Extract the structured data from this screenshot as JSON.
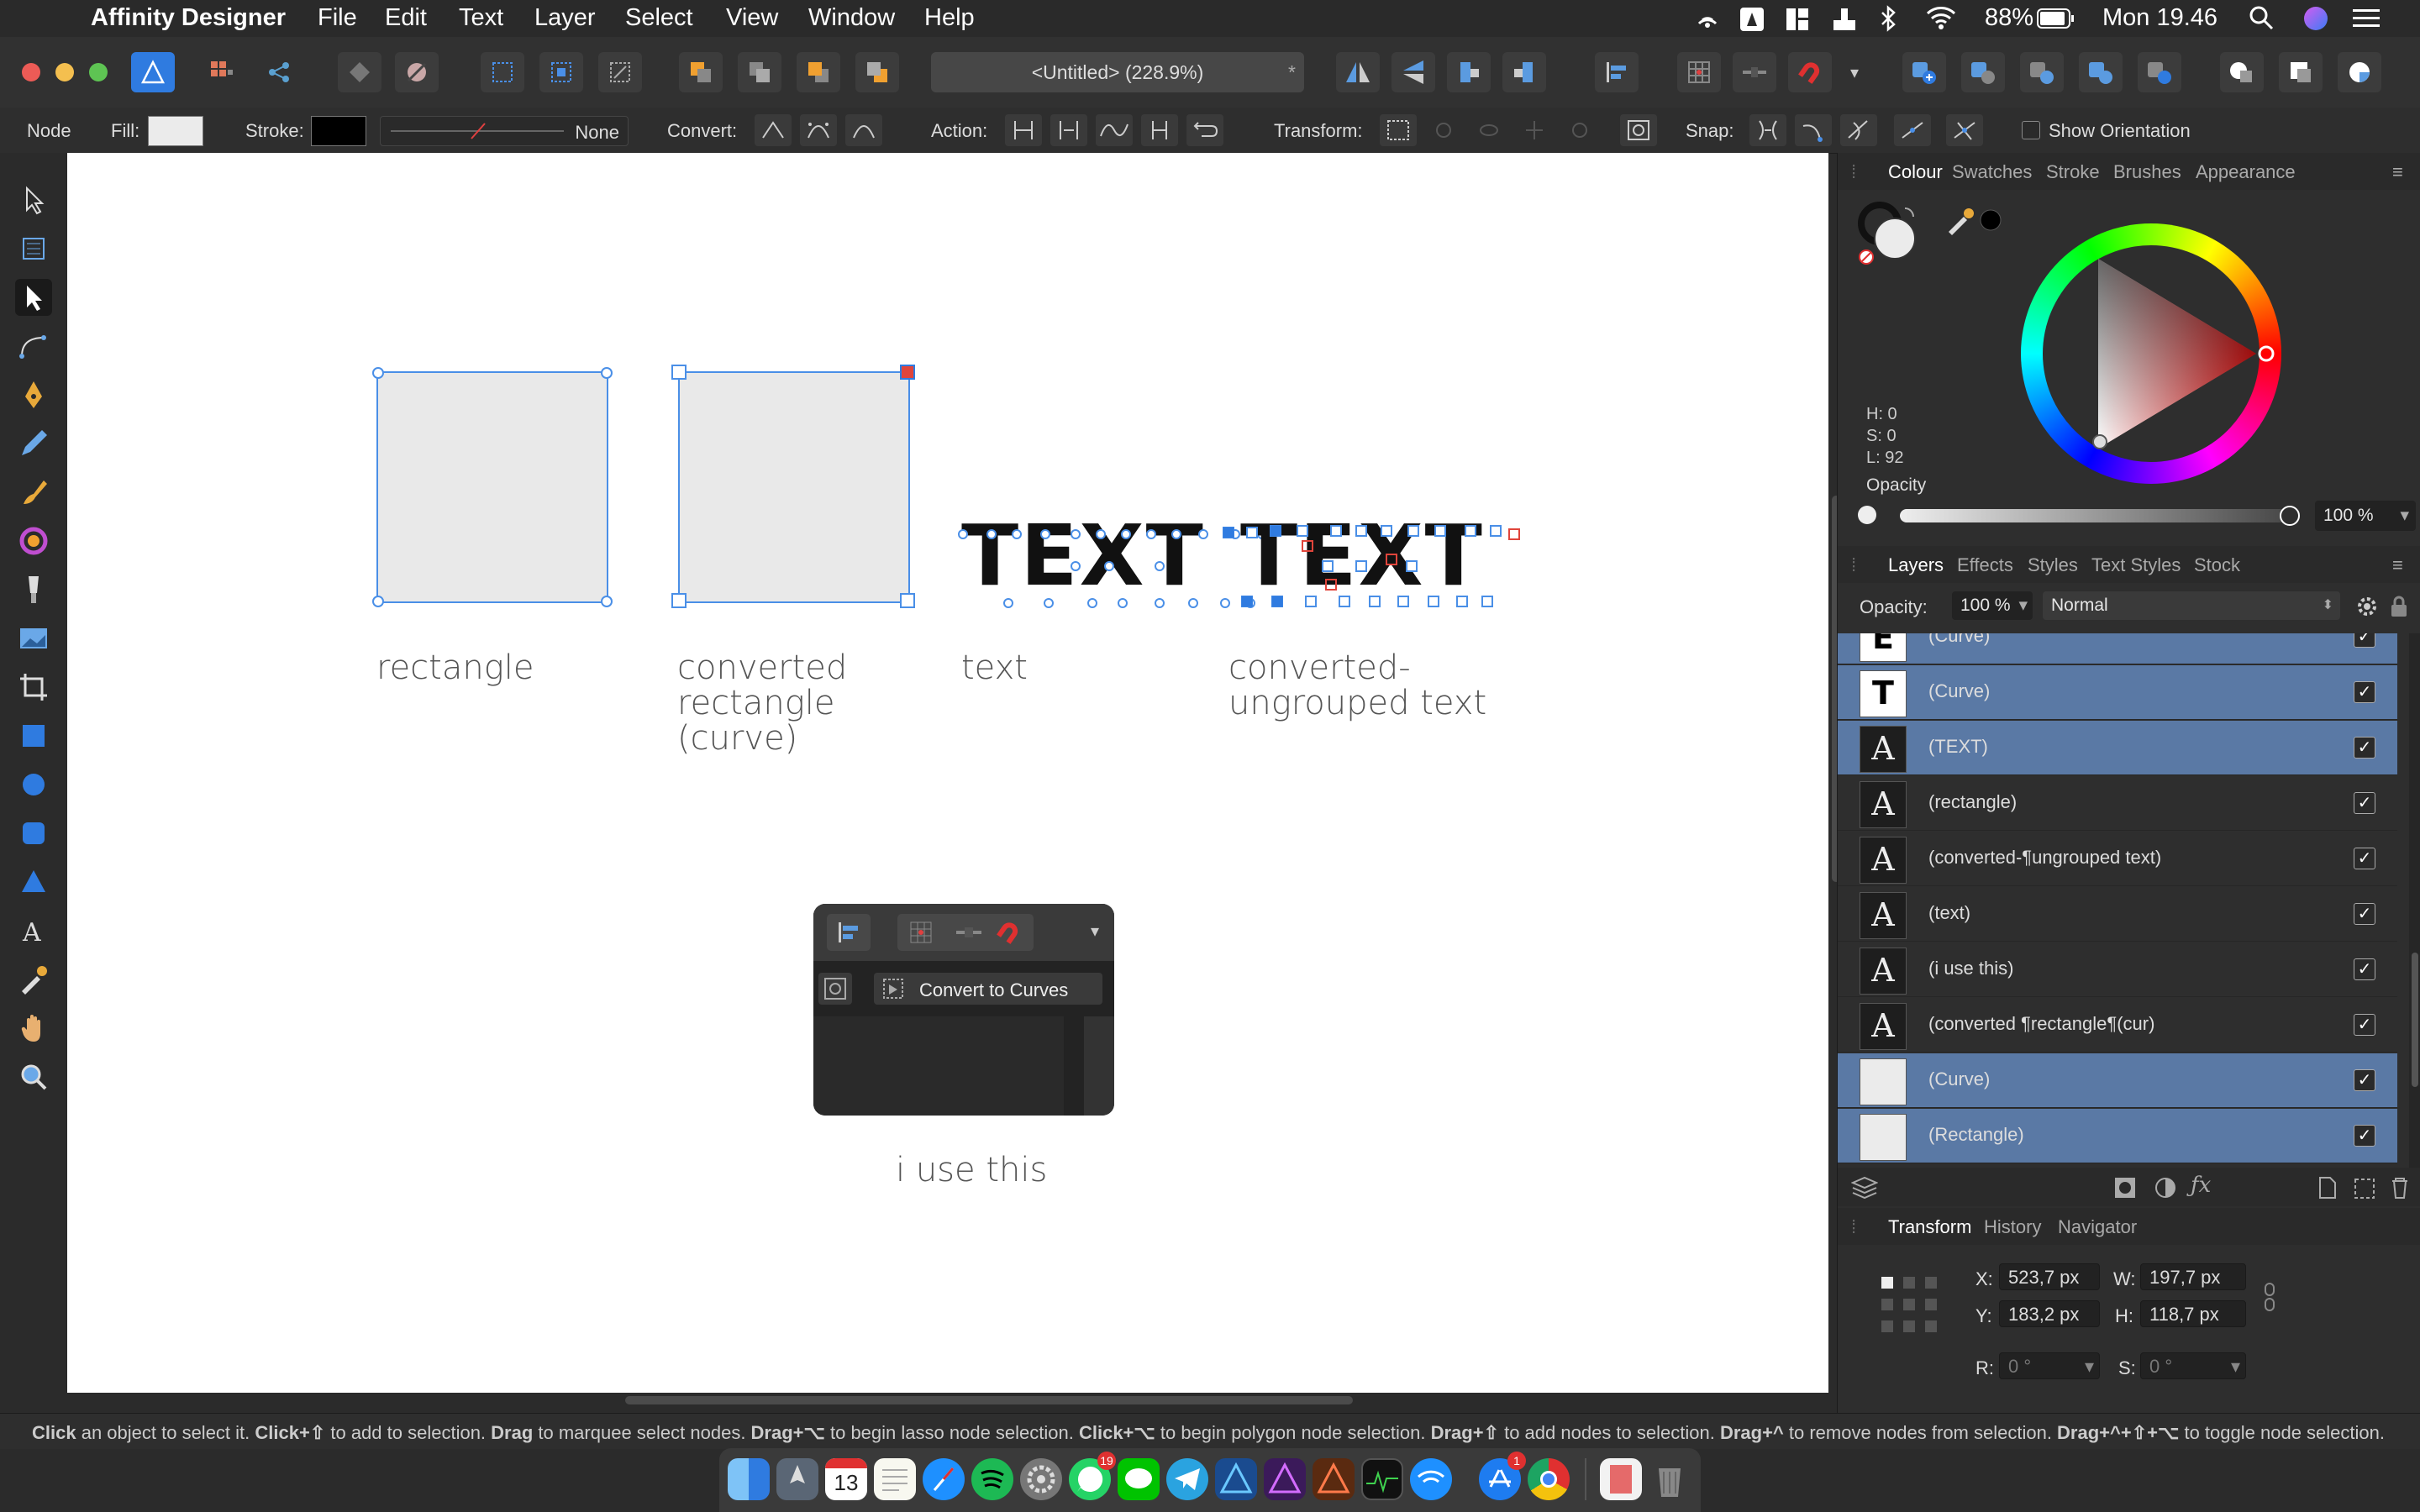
{
  "menubar": {
    "app_name": "Affinity Designer",
    "items": [
      "File",
      "Edit",
      "Text",
      "Layer",
      "Select",
      "View",
      "Window",
      "Help"
    ],
    "battery": "88%",
    "clock": "Mon 19.46"
  },
  "toolbar": {
    "doc_title": "<Untitled> (228.9%)",
    "modified_mark": "*"
  },
  "context": {
    "mode": "Node",
    "fill_label": "Fill:",
    "stroke_label": "Stroke:",
    "stroke_style": "None",
    "convert_label": "Convert:",
    "action_label": "Action:",
    "transform_label": "Transform:",
    "snap_label": "Snap:",
    "show_orientation": "Show Orientation"
  },
  "canvas": {
    "captions": {
      "rectangle": "rectangle",
      "converted_line1": "converted",
      "converted_line2": "rectangle",
      "converted_line3": "(curve)",
      "text": "text",
      "converted_text_line1": "converted-",
      "converted_text_line2": "ungrouped text",
      "i_use_this": "i use this"
    },
    "text_art": "TEXT",
    "popup_button": "Convert to Curves"
  },
  "colour_panel": {
    "tabs": [
      "Colour",
      "Swatches",
      "Stroke",
      "Brushes",
      "Appearance"
    ],
    "h": "H: 0",
    "s": "S: 0",
    "l": "L: 92",
    "opacity_label": "Opacity",
    "opacity_value": "100 %"
  },
  "layers_panel": {
    "tabs": [
      "Layers",
      "Effects",
      "Styles",
      "Text Styles",
      "Stock"
    ],
    "opacity_label": "Opacity:",
    "opacity_value": "100 %",
    "blend_mode": "Normal",
    "rows": [
      {
        "thumb": "E",
        "name": "(Curve)",
        "selected": true
      },
      {
        "thumb": "T",
        "name": "(Curve)",
        "selected": true
      },
      {
        "thumb": "A",
        "name": "(TEXT)",
        "selected": true
      },
      {
        "thumb": "A",
        "name": "(rectangle)",
        "selected": false
      },
      {
        "thumb": "A",
        "name": "(converted-¶ungrouped text)",
        "selected": false
      },
      {
        "thumb": "A",
        "name": "(text)",
        "selected": false
      },
      {
        "thumb": "A",
        "name": "(i use this)",
        "selected": false
      },
      {
        "thumb": "A",
        "name": "(converted ¶rectangle¶(cur)",
        "selected": false
      },
      {
        "thumb": "",
        "name": "(Curve)",
        "selected": true
      },
      {
        "thumb": "",
        "name": "(Rectangle)",
        "selected": true
      }
    ]
  },
  "transform_panel": {
    "tabs": [
      "Transform",
      "History",
      "Navigator"
    ],
    "x_label": "X:",
    "x_value": "523,7 px",
    "y_label": "Y:",
    "y_value": "183,2 px",
    "w_label": "W:",
    "w_value": "197,7 px",
    "h_label": "H:",
    "h_value": "118,7 px",
    "r_label": "R:",
    "r_value": "0 °",
    "s_label": "S:",
    "s_value": "0 °"
  },
  "statusbar": {
    "segments": [
      {
        "b": "Click",
        "t": " an object to select it. "
      },
      {
        "b": "Click+⇧",
        "t": " to add to selection. "
      },
      {
        "b": "Drag",
        "t": " to marquee select nodes. "
      },
      {
        "b": "Drag+⌥",
        "t": " to begin lasso node selection. "
      },
      {
        "b": "Click+⌥",
        "t": " to begin polygon node selection. "
      },
      {
        "b": "Drag+⇧",
        "t": " to add nodes to selection. "
      },
      {
        "b": "Drag+^",
        "t": " to remove nodes from selection. "
      },
      {
        "b": "Drag+^+⇧+⌥",
        "t": " to toggle node selection."
      }
    ]
  },
  "dock": {
    "calendar_day": "13",
    "badge_whatsapp": "19",
    "badge_appstore": "1"
  },
  "colors": {
    "accent": "#4a8fe7",
    "selection_row": "#5a79a5",
    "canvas": "#ffffff"
  }
}
